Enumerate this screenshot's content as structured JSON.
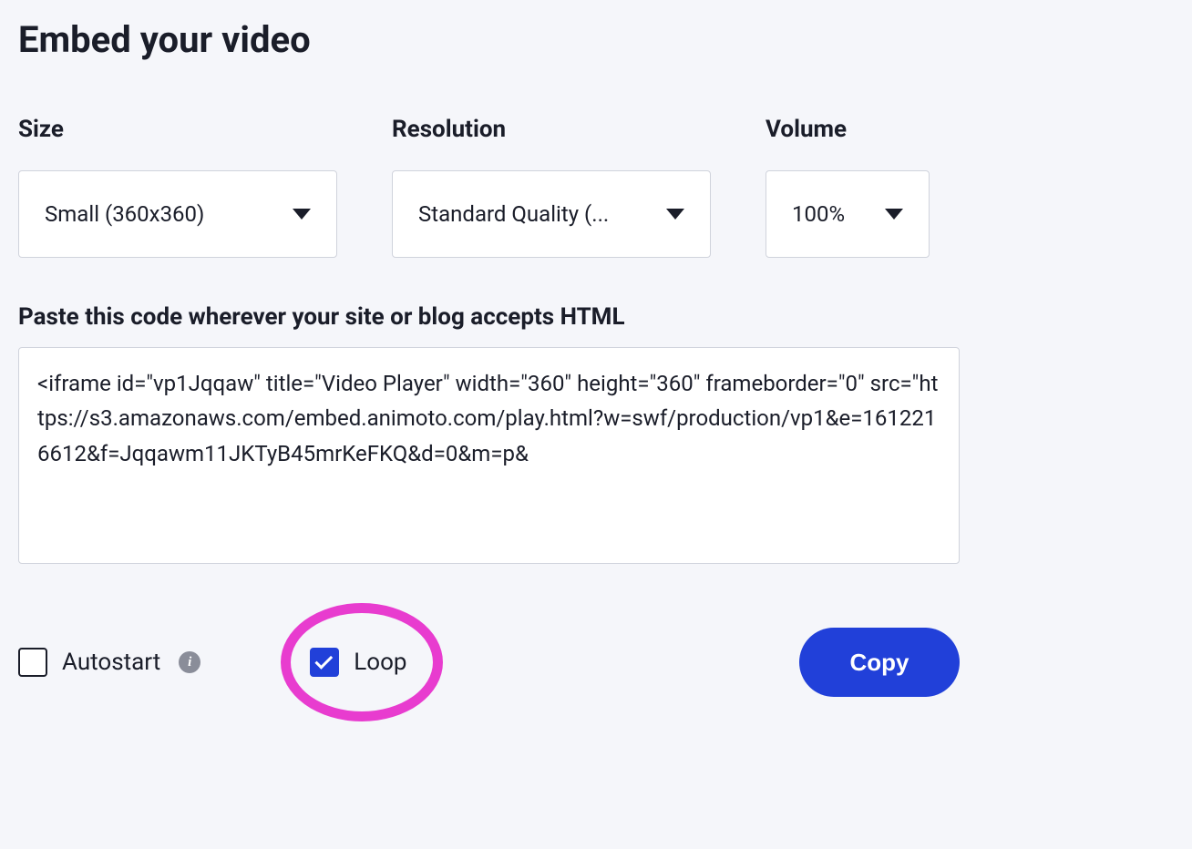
{
  "title": "Embed your video",
  "controls": {
    "size": {
      "label": "Size",
      "value": "Small (360x360)"
    },
    "resolution": {
      "label": "Resolution",
      "value": "Standard Quality (..."
    },
    "volume": {
      "label": "Volume",
      "value": "100%"
    }
  },
  "code_section": {
    "label": "Paste this code wherever your site or blog accepts HTML",
    "code": "<iframe id=\"vp1Jqqaw\" title=\"Video Player\" width=\"360\" height=\"360\" frameborder=\"0\" src=\"https://s3.amazonaws.com/embed.animoto.com/play.html?w=swf/production/vp1&e=1612216612&f=Jqqawm11JKTyB45mrKeFKQ&d=0&m=p&"
  },
  "options": {
    "autostart": {
      "label": "Autostart",
      "checked": false
    },
    "loop": {
      "label": "Loop",
      "checked": true
    }
  },
  "copy_button": "Copy",
  "icons": {
    "info": "i"
  }
}
